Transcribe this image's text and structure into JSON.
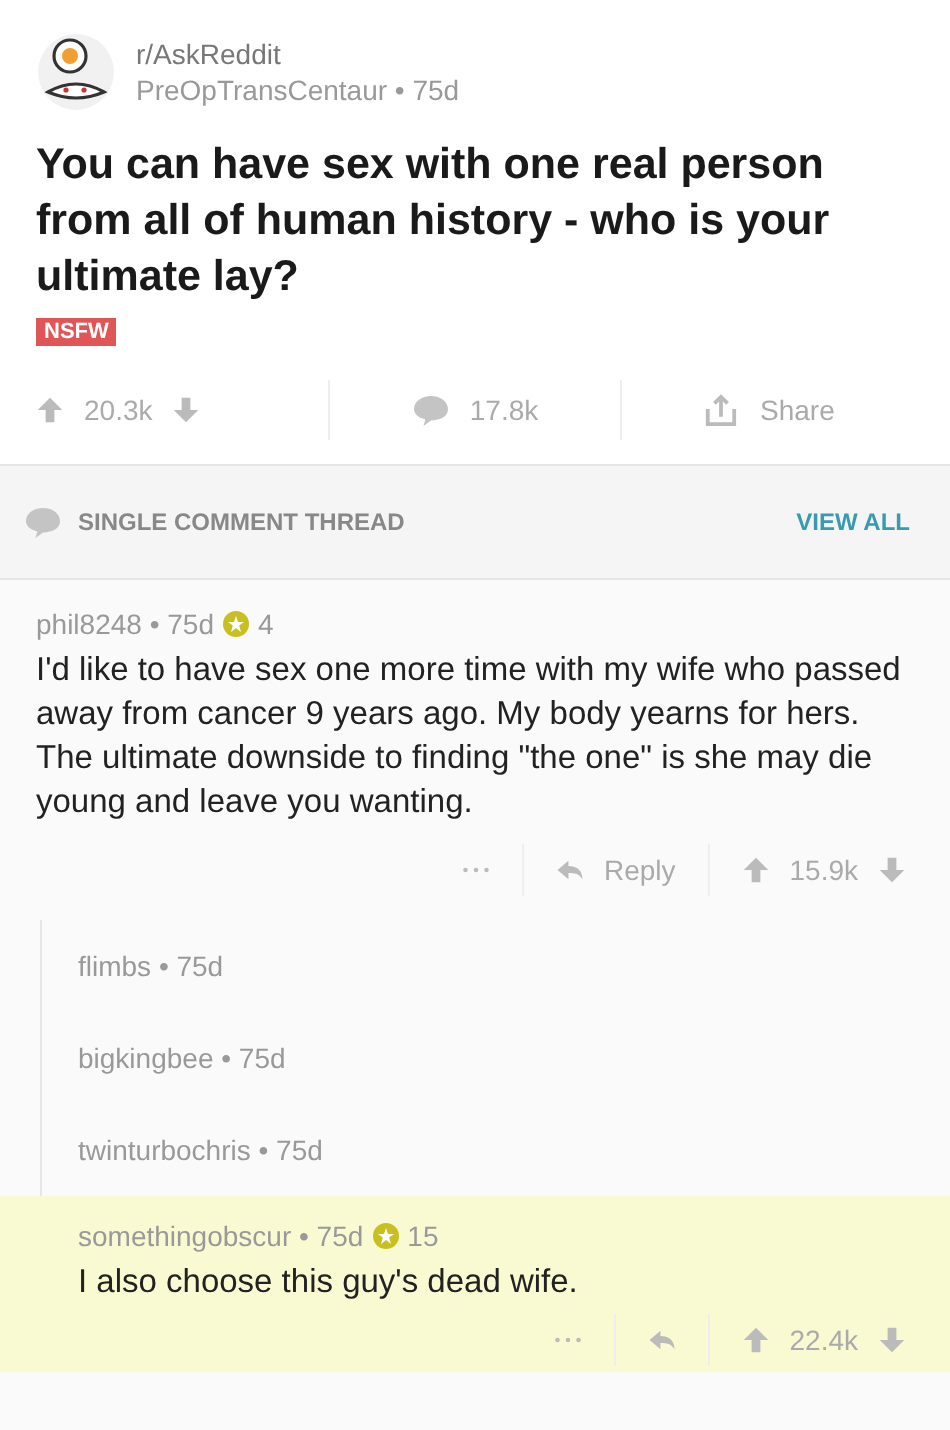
{
  "post": {
    "subreddit": "r/AskReddit",
    "meta": "PreOpTransCentaur • 75d",
    "title": "You can have sex with one real person from all of human history - who is your ultimate lay?",
    "tag": "NSFW",
    "score": "20.3k",
    "comments": "17.8k",
    "share": "Share"
  },
  "thread_bar": {
    "label": "SINGLE COMMENT THREAD",
    "link": "VIEW ALL"
  },
  "comment": {
    "meta": "phil8248 • 75d",
    "awards": "4",
    "body": "I'd like to have sex one more time with my wife who passed away from cancer 9 years ago.  My body yearns for hers.  The ultimate downside to finding \"the one\" is she may die young and leave you wanting.",
    "reply": "Reply",
    "score": "15.9k",
    "highlighted": false,
    "children": [
      {
        "kind": "collapsed",
        "meta": "flimbs • 75d",
        "highlighted": false
      },
      {
        "kind": "collapsed",
        "meta": "bigkingbee • 75d",
        "highlighted": false
      },
      {
        "kind": "collapsed",
        "meta": "twinturbochris • 75d",
        "highlighted": false
      },
      {
        "kind": "full",
        "meta": "somethingobscur • 75d",
        "awards": "15",
        "body": "I also choose this guy's dead wife.",
        "score": "22.4k",
        "highlighted": true
      }
    ]
  }
}
